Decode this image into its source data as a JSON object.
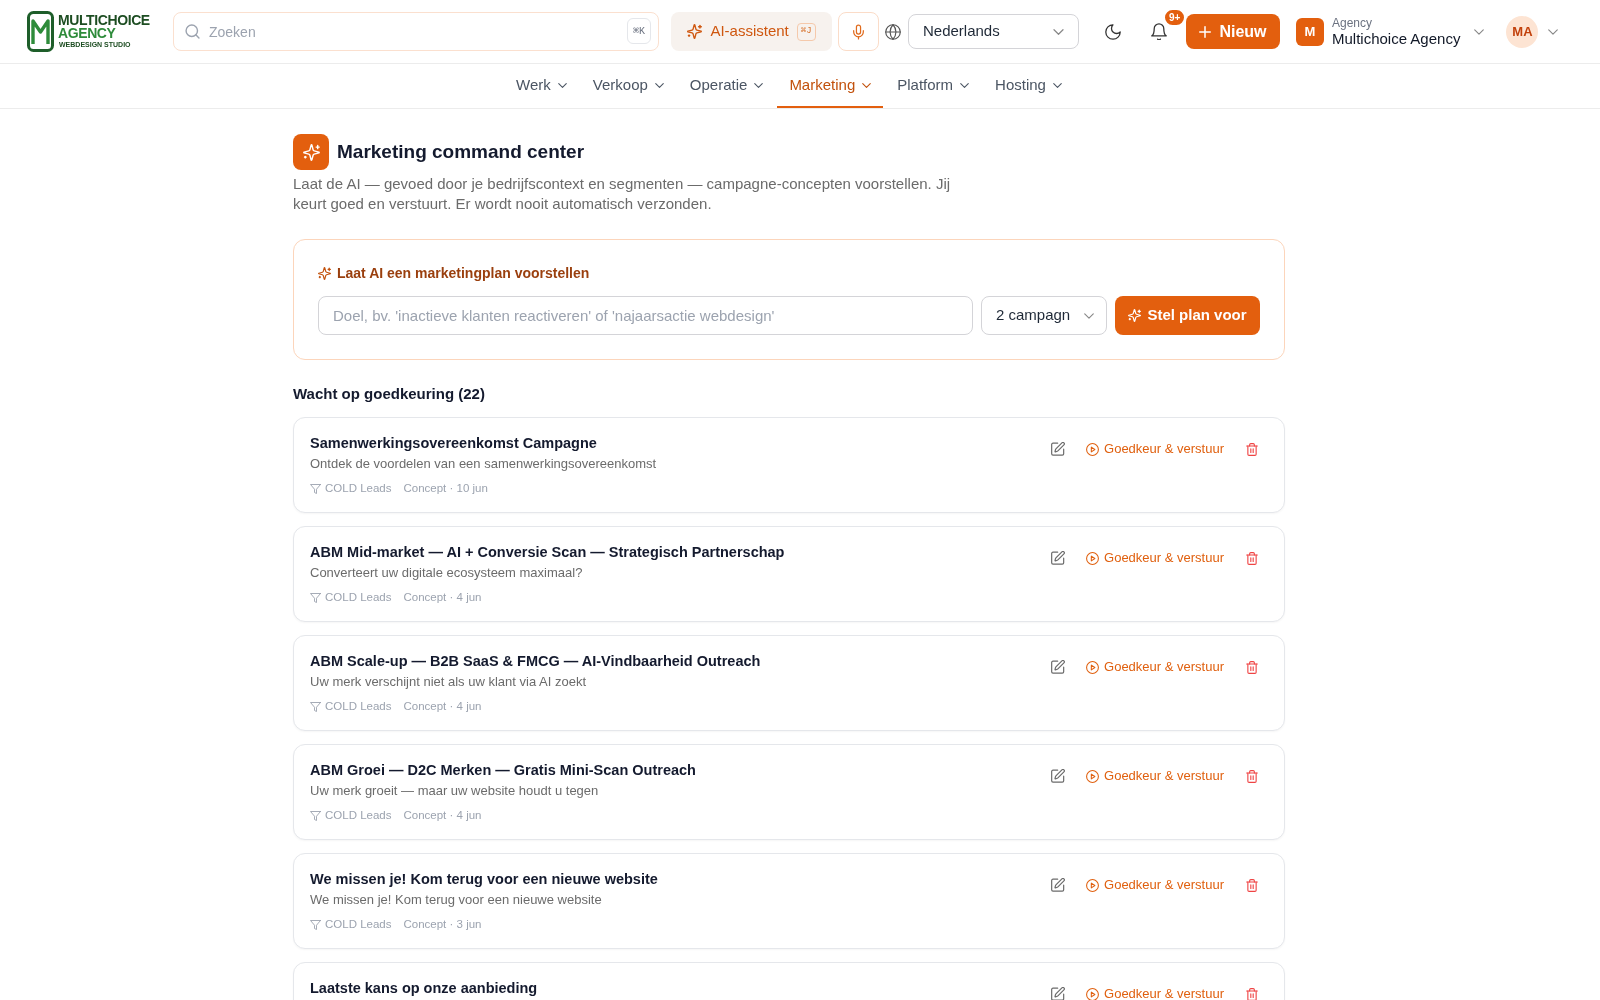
{
  "header": {
    "logo": {
      "line_1": "MULTICHOICE",
      "line_2": "AGENCY",
      "tagline": "WEBDESIGN STUDIO"
    },
    "search": {
      "placeholder": "Zoeken",
      "shortcut": "⌘K"
    },
    "ai_button": {
      "label": "AI-assistent",
      "shortcut": "⌘J"
    },
    "language_select": {
      "value": "Nederlands"
    },
    "notifications": {
      "badge": "9+"
    },
    "new_button": {
      "label": "Nieuw"
    },
    "workspace": {
      "initial": "M",
      "label": "Agency",
      "name": "Multichoice Agency"
    },
    "user": {
      "initials": "MA"
    }
  },
  "nav": [
    {
      "label": "Werk",
      "selected": false
    },
    {
      "label": "Verkoop",
      "selected": false
    },
    {
      "label": "Operatie",
      "selected": false
    },
    {
      "label": "Marketing",
      "selected": true
    },
    {
      "label": "Platform",
      "selected": false
    },
    {
      "label": "Hosting",
      "selected": false
    }
  ],
  "page": {
    "title": "Marketing command center",
    "description": "Laat de AI — gevoed door je bedrijfscontext en segmenten — campagne-concepten voorstellen. Jij keurt goed en verstuurt. Er wordt nooit automatisch verzonden."
  },
  "plan_card": {
    "heading": "Laat AI een marketingplan voorstellen",
    "goal_field": {
      "placeholder": "Doel, bv. 'inactieve klanten reactiveren' of 'najaarsactie webdesign'"
    },
    "count_select": {
      "value": "2 campagn"
    },
    "submit_button": "Stel plan voor"
  },
  "queue": {
    "heading": "Wacht op goedkeuring (22)",
    "items": [
      {
        "title": "Samenwerkingsovereenkomst Campagne",
        "subtitle": "Ontdek de voordelen van een samenwerkingsovereenkomst",
        "segment": "COLD Leads",
        "meta": "Concept · 10 jun",
        "approve_label": "Goedkeur & verstuur"
      },
      {
        "title": "ABM Mid-market — AI + Conversie Scan — Strategisch Partnerschap",
        "subtitle": "Converteert uw digitale ecosysteem maximaal?",
        "segment": "COLD Leads",
        "meta": "Concept · 4 jun",
        "approve_label": "Goedkeur & verstuur"
      },
      {
        "title": "ABM Scale-up — B2B SaaS & FMCG — AI-Vindbaarheid Outreach",
        "subtitle": "Uw merk verschijnt niet als uw klant via AI zoekt",
        "segment": "COLD Leads",
        "meta": "Concept · 4 jun",
        "approve_label": "Goedkeur & verstuur"
      },
      {
        "title": "ABM Groei — D2C Merken — Gratis Mini-Scan Outreach",
        "subtitle": "Uw merk groeit — maar uw website houdt u tegen",
        "segment": "COLD Leads",
        "meta": "Concept · 4 jun",
        "approve_label": "Goedkeur & verstuur"
      },
      {
        "title": "We missen je! Kom terug voor een nieuwe website",
        "subtitle": "We missen je! Kom terug voor een nieuwe website",
        "segment": "COLD Leads",
        "meta": "Concept · 3 jun",
        "approve_label": "Goedkeur & verstuur"
      },
      {
        "title": "Laatste kans op onze aanbieding",
        "approve_label": "Goedkeur & verstuur"
      }
    ]
  }
}
